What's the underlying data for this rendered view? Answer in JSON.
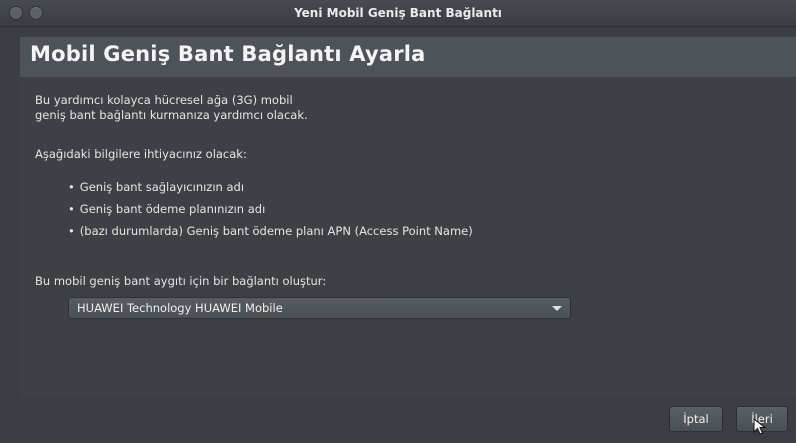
{
  "window": {
    "title": "Yeni Mobil Geniş Bant Bağlantı"
  },
  "banner": {
    "title": "Mobil Geniş Bant Bağlantı Ayarla"
  },
  "intro": {
    "line1": "Bu yardımcı kolayca hücresel ağa (3G) mobil",
    "line2": "geniş bant bağlantı kurmanıza yardımcı olacak."
  },
  "requirements": {
    "label": "Aşağıdaki bilgilere ihtiyacınız olacak:",
    "items": [
      "Geniş bant sağlayıcınızın adı",
      "Geniş bant ödeme planınızın adı",
      "(bazı durumlarda) Geniş bant ödeme planı APN (Access Point Name)"
    ]
  },
  "device": {
    "label": "Bu mobil geniş bant aygıtı için bir bağlantı oluştur:",
    "selected": "HUAWEI Technology HUAWEI Mobile"
  },
  "buttons": {
    "cancel": "İptal",
    "next": "İleri"
  }
}
